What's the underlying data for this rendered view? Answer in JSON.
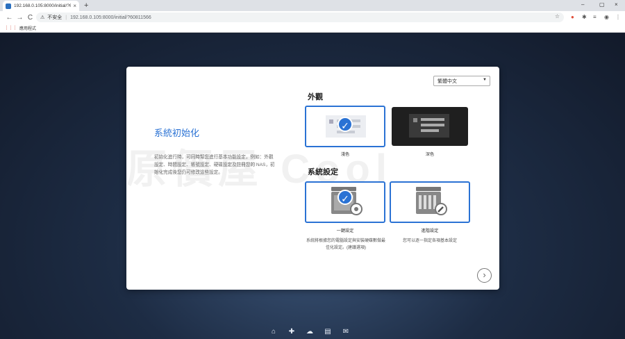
{
  "browser": {
    "tab_title": "192.168.0.105:8000/initial/?60",
    "tab_close": "×",
    "new_tab": "+",
    "nav_back": "←",
    "nav_forward": "→",
    "nav_reload": "C",
    "security_warning": "不安全",
    "url": "192.168.0.105:8000/initial/?60811566",
    "bookmarks_label": "應用程式",
    "win_minimize": "–",
    "win_maximize": "▢",
    "win_close": "×"
  },
  "dialog": {
    "language": "繁體中文",
    "title": "系統初始化",
    "description": "初始化進行時，可同時幫您進行基本功能設定，例如：外觀設定、時間設定、帳號設定、硬碟設定及註冊您的 NAS，初始化完成後您仍可修改這些設定。",
    "watermark": "原價屋 Cool",
    "appearance": {
      "section_title": "外觀",
      "light_label": "淺色",
      "dark_label": "深色"
    },
    "setup": {
      "section_title": "系統設定",
      "quick_label": "一鍵設定",
      "quick_desc": "系統將根據您的電腦設定與安裝硬碟數做最佳化設定。(建議選項)",
      "advanced_label": "進階設定",
      "advanced_desc": "您可以逐一指定各項基本設定"
    },
    "next": "›"
  },
  "colors": {
    "accent": "#2a72d4",
    "card_dark": "#222222",
    "card_light": "#f0f0f2"
  }
}
